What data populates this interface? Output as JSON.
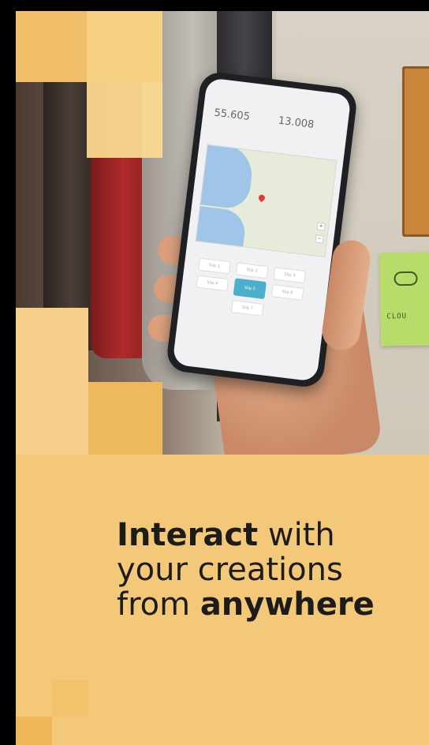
{
  "phone_screen": {
    "stat_left": "55.605",
    "stat_right": "13.008",
    "control_buttons": [
      "Slip 1",
      "Slip 2",
      "Slip 3",
      "Slip 4",
      "Slip 5",
      "Slip 6",
      "Slip 7"
    ]
  },
  "tagline": {
    "line1_bold": "Interact",
    "line1_regular": "with",
    "line2_regular": "your creations",
    "line3_regular": "from",
    "line3_bold": "anywhere"
  },
  "colors": {
    "background": "#f3c979",
    "accent_button": "#4ab0cc",
    "text": "#1e1c1a"
  },
  "icons": [
    "map-pin-icon",
    "cloud-icon"
  ]
}
